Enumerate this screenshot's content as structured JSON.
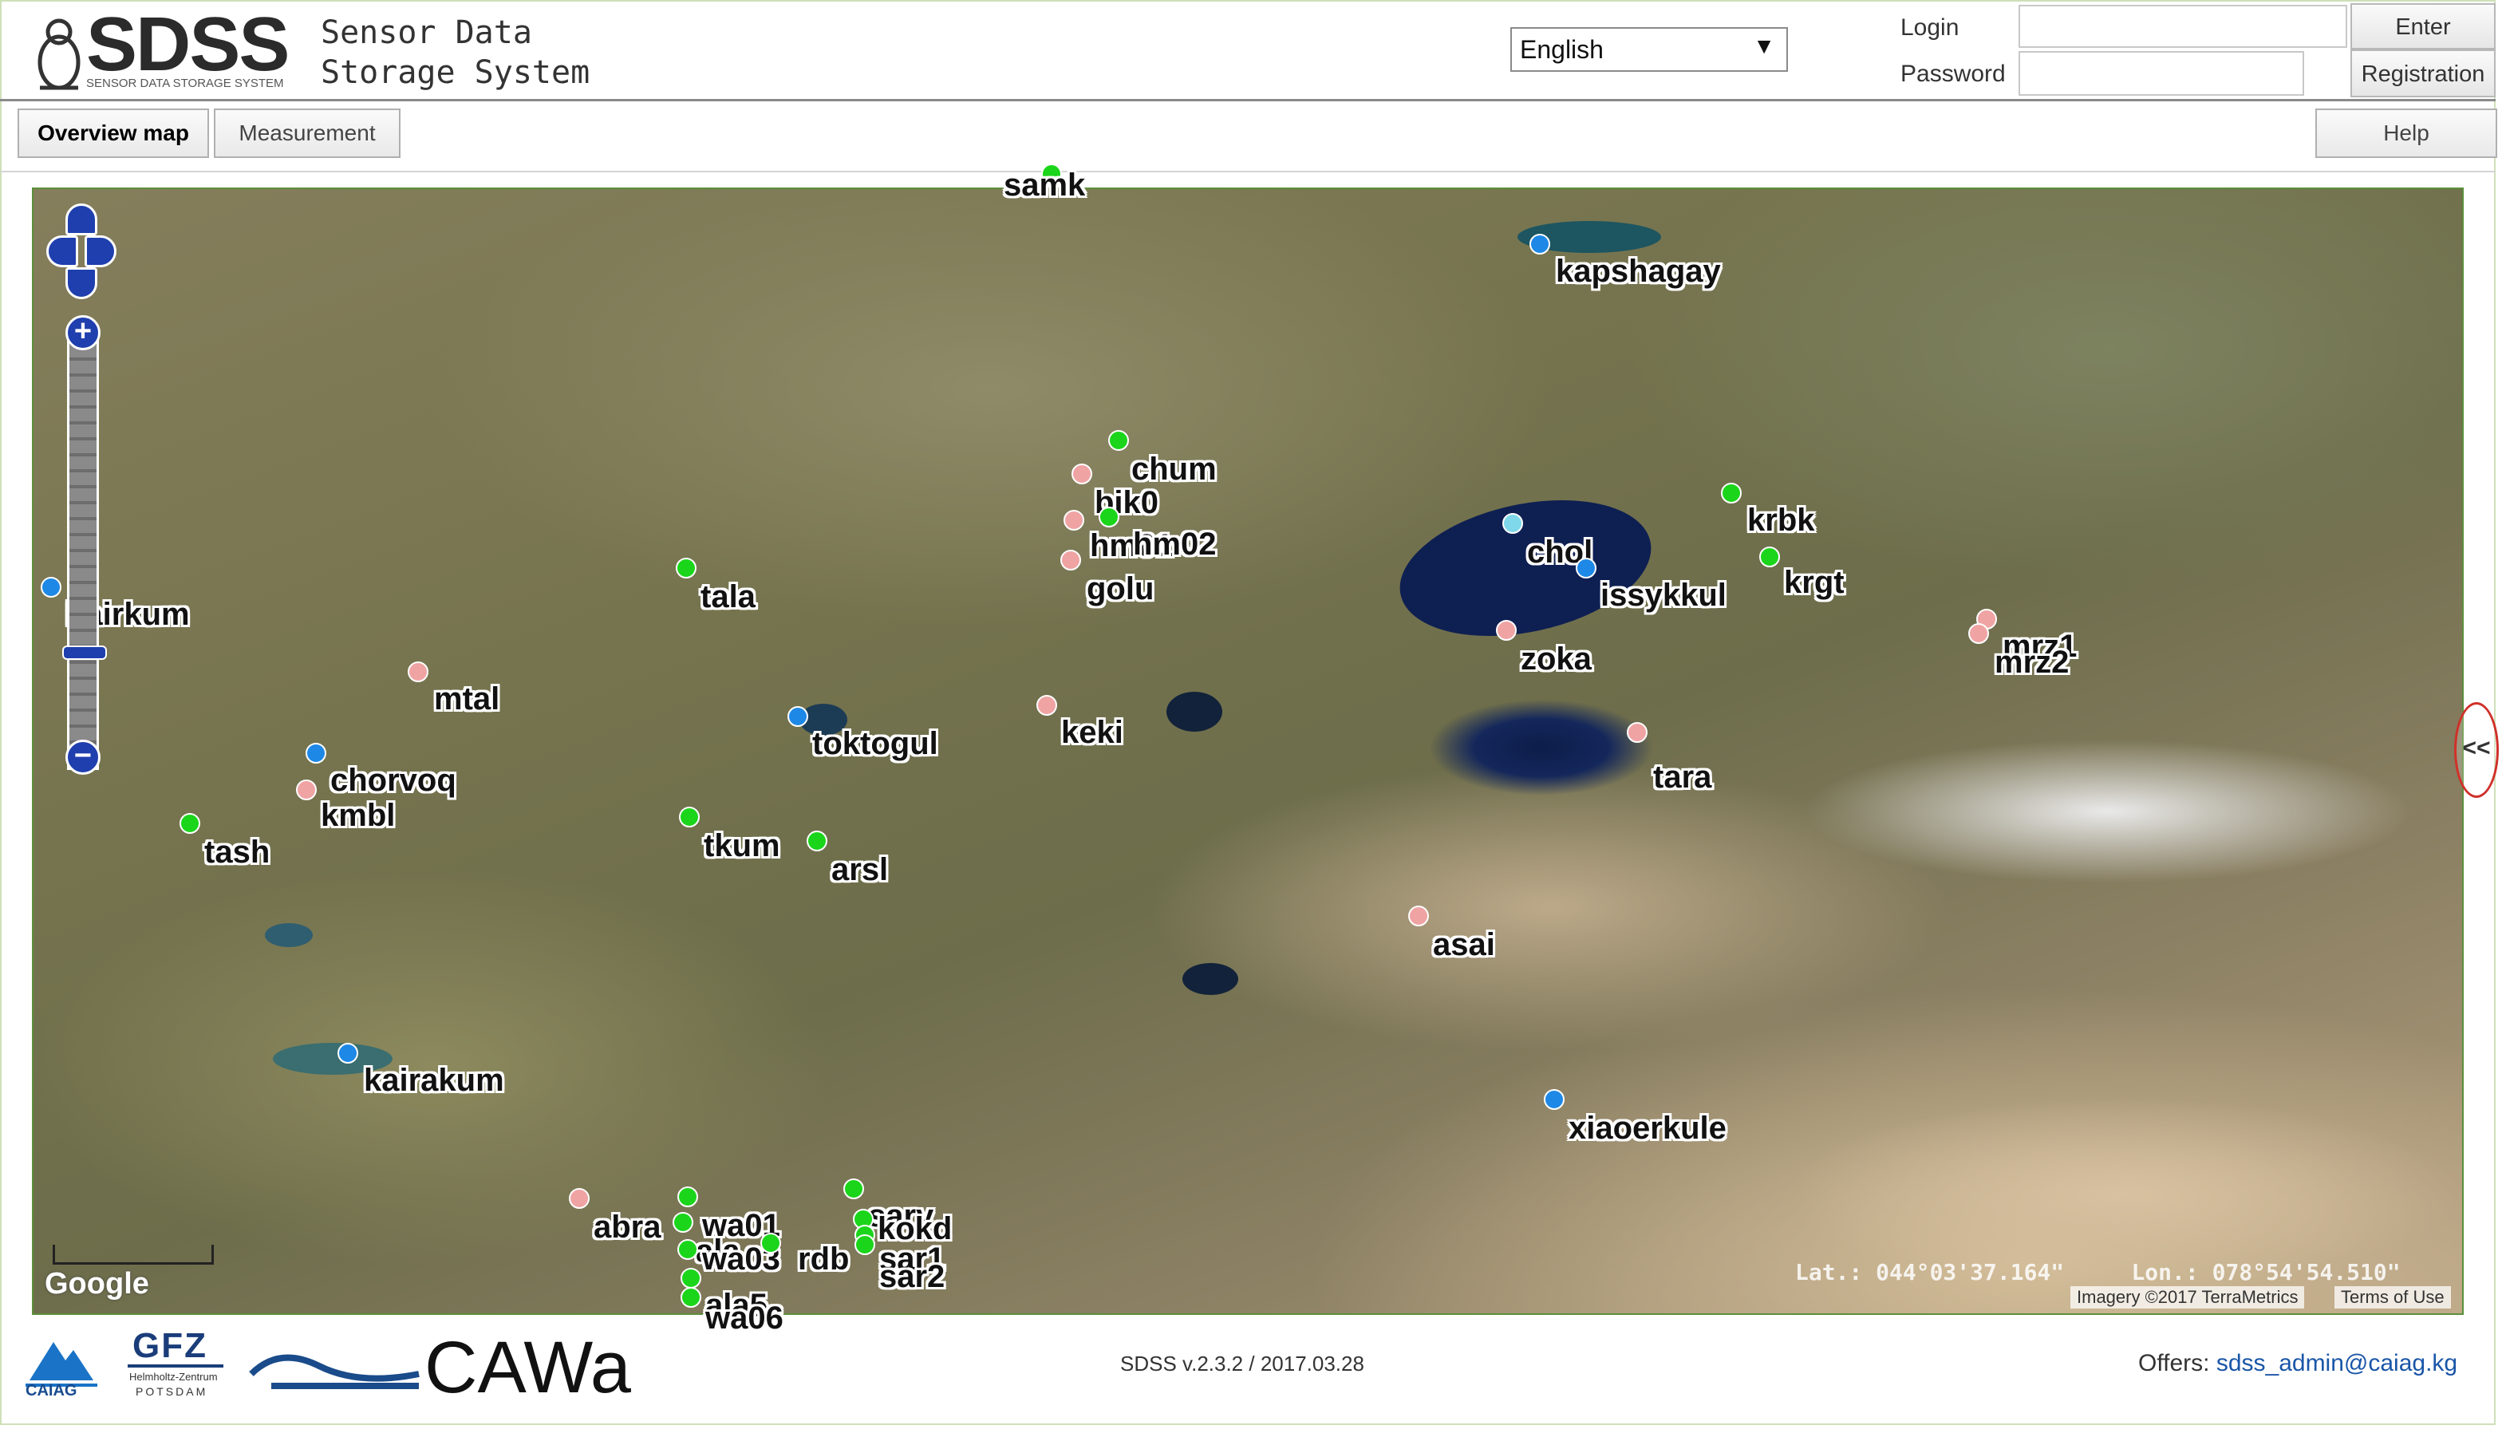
{
  "header": {
    "logo": "SDSS",
    "logo_sub": "SENSOR DATA STORAGE SYSTEM",
    "title_line1": "Sensor Data",
    "title_line2": "Storage System",
    "language": "English",
    "login_label": "Login",
    "password_label": "Password",
    "enter_label": "Enter",
    "registration_label": "Registration",
    "login_value": "",
    "password_value": ""
  },
  "tabs": {
    "overview": "Overview map",
    "measurement": "Measurement",
    "help": "Help"
  },
  "map": {
    "stations": [
      {
        "label": "samk",
        "color": "green"
      },
      {
        "label": "kapshagay",
        "color": "blue"
      },
      {
        "label": "chum",
        "color": "green"
      },
      {
        "label": "bik0",
        "color": "pink"
      },
      {
        "label": "hm01",
        "color": "pink"
      },
      {
        "label": "hm02",
        "color": "green"
      },
      {
        "label": "golu",
        "color": "pink"
      },
      {
        "label": "krbk",
        "color": "green"
      },
      {
        "label": "krgt",
        "color": "green"
      },
      {
        "label": "chol",
        "color": "cyan"
      },
      {
        "label": "issykkul",
        "color": "blue"
      },
      {
        "label": "zoka",
        "color": "pink"
      },
      {
        "label": "tala",
        "color": "green"
      },
      {
        "label": "bairkum",
        "color": "blue"
      },
      {
        "label": "mtal",
        "color": "pink"
      },
      {
        "label": "toktogul",
        "color": "blue"
      },
      {
        "label": "keki",
        "color": "pink"
      },
      {
        "label": "mrz1",
        "color": "pink"
      },
      {
        "label": "mrz2",
        "color": "pink"
      },
      {
        "label": "chorvoq",
        "color": "blue"
      },
      {
        "label": "kmbl",
        "color": "pink"
      },
      {
        "label": "tash",
        "color": "green"
      },
      {
        "label": "tara",
        "color": "pink"
      },
      {
        "label": "tkum",
        "color": "green"
      },
      {
        "label": "arsl",
        "color": "green"
      },
      {
        "label": "asai",
        "color": "pink"
      },
      {
        "label": "kairakum",
        "color": "blue"
      },
      {
        "label": "xiaoerkule",
        "color": "blue"
      },
      {
        "label": "abra",
        "color": "pink"
      },
      {
        "label": "wa01",
        "color": "green"
      },
      {
        "label": "ala",
        "color": "green"
      },
      {
        "label": "wa03",
        "color": "green"
      },
      {
        "label": "rdb",
        "color": "green"
      },
      {
        "label": "ala5",
        "color": "green"
      },
      {
        "label": "wa06",
        "color": "green"
      },
      {
        "label": "sary",
        "color": "green"
      },
      {
        "label": "kokd",
        "color": "green"
      },
      {
        "label": "sar1",
        "color": "green"
      },
      {
        "label": "sar2",
        "color": "green"
      }
    ],
    "lat": "Lat.: 044°03'37.164\"",
    "lon": "Lon.: 078°54'54.510\"",
    "imagery": "Imagery ©2017 TerraMetrics",
    "terms": "Terms of Use",
    "google": "Google",
    "collapse": "<<"
  },
  "footer": {
    "version": "SDSS v.2.3.2 / 2017.03.28",
    "offers_label": "Offers:",
    "offers_email": "sdss_admin@caiag.kg",
    "caiag": "CAIAG",
    "gfz": "GFZ",
    "gfz_sub1": "Helmholtz-Zentrum",
    "gfz_sub2": "POTSDAM",
    "cawa": "CAWa"
  },
  "colors": {
    "green": "#1bd51b",
    "blue": "#1e88e6",
    "pink": "#f0a3a3",
    "cyan": "#7fd8ea",
    "map_border": "#5b8f3a",
    "link": "#1a56a8"
  }
}
